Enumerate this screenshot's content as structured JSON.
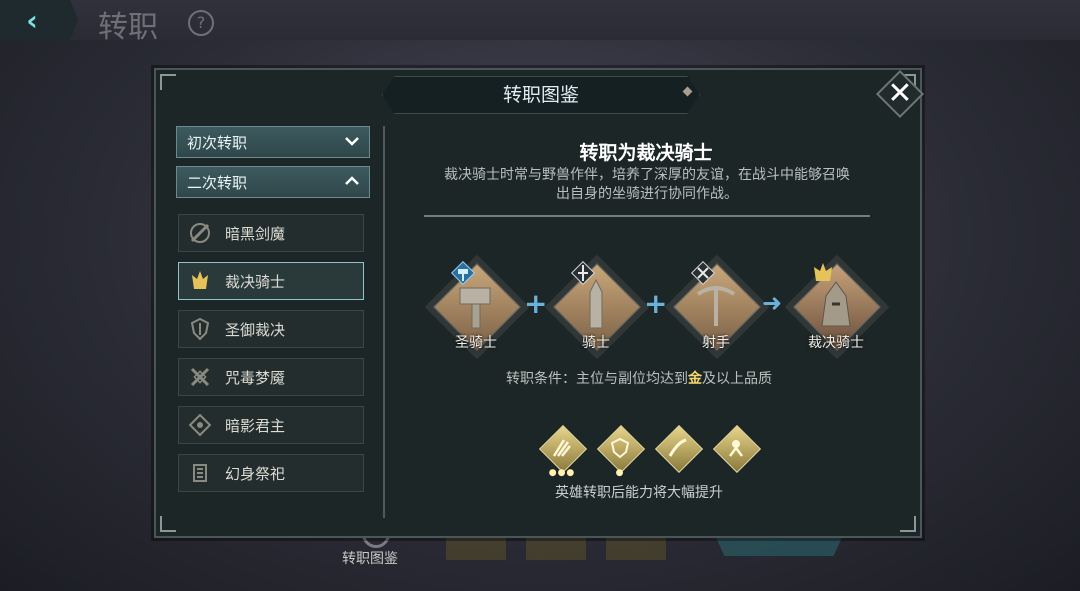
{
  "screen": {
    "title": "转职",
    "help_glyph": "?",
    "back_glyph": "‹"
  },
  "bottom_bar": {
    "label": "转职图鉴"
  },
  "modal": {
    "title": "转职图鉴",
    "close_glyph": "✕",
    "menu": {
      "first": {
        "label": "初次转职",
        "chevron": "⌄"
      },
      "second": {
        "label": "二次转职",
        "chevron": "⌃"
      },
      "classes": [
        {
          "label": "暗黑剑魔",
          "icon": "sword-icon",
          "active": false
        },
        {
          "label": "裁决骑士",
          "icon": "crown-icon",
          "active": true
        },
        {
          "label": "圣御裁决",
          "icon": "shield-icon",
          "active": false
        },
        {
          "label": "咒毒梦魇",
          "icon": "crossed-blades-icon",
          "active": false
        },
        {
          "label": "暗影君主",
          "icon": "eye-icon",
          "active": false
        },
        {
          "label": "幻身祭祀",
          "icon": "totem-icon",
          "active": false
        }
      ]
    },
    "detail": {
      "heading": "转职为裁决骑士",
      "description": "裁决骑士时常与野兽作伴，培养了深厚的友谊，在战斗中能够召唤出自身的坐骑进行协同作战。",
      "formula": {
        "inputs": [
          {
            "label": "圣骑士",
            "icon": "hammer-icon"
          },
          {
            "label": "骑士",
            "icon": "lance-icon"
          },
          {
            "label": "射手",
            "icon": "crossbow-icon"
          }
        ],
        "plus": "+",
        "arrow": "➜",
        "result": {
          "label": "裁决骑士",
          "icon": "crown-icon"
        }
      },
      "condition": {
        "prefix": "转职条件：主位与副位均达到",
        "highlight": "金",
        "suffix": "及以上品质"
      },
      "abilities": [
        {
          "icon": "blades-skill-icon",
          "dots": "●●●"
        },
        {
          "icon": "shield-skill-icon",
          "dots": "●"
        },
        {
          "icon": "slash-skill-icon",
          "dots": ""
        },
        {
          "icon": "rage-skill-icon",
          "dots": ""
        }
      ],
      "abilities_caption": "英雄转职后能力将大幅提升"
    }
  },
  "colors": {
    "gold": "#f5d76e",
    "accent": "#8fc3c6",
    "plus": "#6ab0d8"
  }
}
